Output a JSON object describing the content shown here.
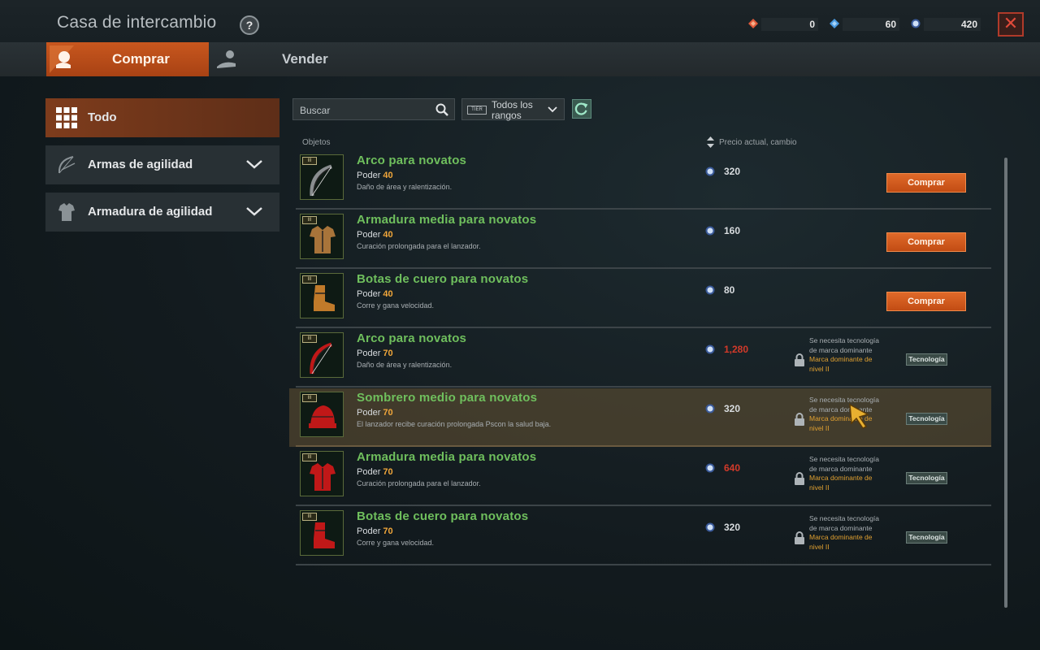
{
  "window": {
    "title": "Casa de intercambio",
    "help": "?"
  },
  "currencies": [
    {
      "icon": "red-gem-icon",
      "amount": "0",
      "color": "#e05a3a"
    },
    {
      "icon": "blue-gem-icon",
      "amount": "60",
      "color": "#4a9ae0"
    },
    {
      "icon": "silver-coin-icon",
      "amount": "420",
      "color": "#8ab0e0"
    }
  ],
  "tabs": {
    "buy": "Comprar",
    "sell": "Vender"
  },
  "categories": [
    {
      "label": "Todo",
      "icon": "grid-icon"
    },
    {
      "label": "Armas de agilidad",
      "icon": "bow-icon"
    },
    {
      "label": "Armadura de agilidad",
      "icon": "armor-icon"
    }
  ],
  "search": {
    "placeholder": "Buscar"
  },
  "rank_filter": {
    "badge": "TIER",
    "label": "Todos los rangos"
  },
  "headers": {
    "items": "Objetos",
    "price": "Precio actual, cambio"
  },
  "labels": {
    "power": "Poder",
    "buy": "Comprar",
    "requirement": "Se necesita tecnología de marca dominante",
    "requirement_brand": "Marca dominante de nivel II",
    "tech": "Tecnología"
  },
  "items": [
    {
      "name": "Arco para novatos",
      "power": "40",
      "desc": "Daño de área y ralentización.",
      "price": "320",
      "tier": "III",
      "state": "buy",
      "price_red": false,
      "icon": "bow-icon",
      "tint": "#8a8e90"
    },
    {
      "name": "Armadura media para novatos",
      "power": "40",
      "desc": "Curación prolongada para el lanzador.",
      "price": "160",
      "tier": "III",
      "state": "buy",
      "price_red": false,
      "icon": "armor-icon",
      "tint": "#a8743a"
    },
    {
      "name": "Botas de cuero para novatos",
      "power": "40",
      "desc": "Corre y gana velocidad.",
      "price": "80",
      "tier": "III",
      "state": "buy",
      "price_red": false,
      "icon": "boots-icon",
      "tint": "#c07a2a"
    },
    {
      "name": "Arco para novatos",
      "power": "70",
      "desc": "Daño de área y ralentización.",
      "price": "1,280",
      "tier": "III",
      "state": "locked",
      "price_red": true,
      "icon": "bow-icon",
      "tint": "#c01818"
    },
    {
      "name": "Sombrero medio para novatos",
      "power": "70",
      "desc": "El lanzador recibe curación prolongada Pscon la salud baja.",
      "price": "320",
      "tier": "III",
      "state": "locked",
      "price_red": false,
      "icon": "hat-icon",
      "tint": "#c01818"
    },
    {
      "name": "Armadura media para novatos",
      "power": "70",
      "desc": "Curación prolongada para el lanzador.",
      "price": "640",
      "tier": "III",
      "state": "locked",
      "price_red": true,
      "icon": "armor-icon",
      "tint": "#c01818"
    },
    {
      "name": "Botas de cuero para novatos",
      "power": "70",
      "desc": "Corre y gana velocidad.",
      "price": "320",
      "tier": "III",
      "state": "locked",
      "price_red": false,
      "icon": "boots-icon",
      "tint": "#c01818"
    }
  ],
  "highlighted_row": 4
}
